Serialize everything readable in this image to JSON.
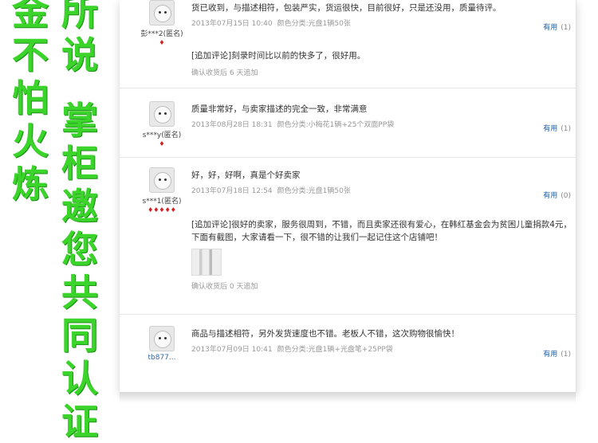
{
  "side_text": {
    "left_column": [
      "金",
      "不",
      "怕",
      "火",
      "炼"
    ],
    "right_column": [
      "所",
      "说",
      "掌",
      "柜",
      "邀",
      "您",
      "共",
      "同",
      "认",
      "证"
    ]
  },
  "reviews": [
    {
      "user": "彭***2(匿名)",
      "rank": "♦",
      "text": "货已收到，与描述相符，包装严实，货运很快，目前很好，只是还没用，质量待评。",
      "date": "2013年07月15日 10:40",
      "variant": "颜色分类:光盘1辆50张",
      "useful_label": "有用",
      "useful_count": "(1)",
      "additional": {
        "text": "[追加评论]刻录时间比以前的快多了，很好用。",
        "confirm": "确认收货后 6 天追加"
      }
    },
    {
      "user": "s***y(匿名)",
      "rank": "♦",
      "text": "质量非常好，与卖家描述的完全一致，非常满意",
      "date": "2013年08月28日 18:31",
      "variant": "颜色分类:小梅花1辆+25个双面PP袋",
      "useful_label": "有用",
      "useful_count": "(1)"
    },
    {
      "user": "s***1(匿名)",
      "rank": "♦♦♦♦♦",
      "text": "好，好，好啊，真是个好卖家",
      "date": "2013年07月18日 12:54",
      "variant": "颜色分类:光盘1辆50张",
      "useful_label": "有用",
      "useful_count": "(0)",
      "additional": {
        "text": "[追加评论]很好的卖家，服务很周到，不错，而且卖家还很有爱心，在韩红基金会为贫困儿童捐款4元，下面有截图，大家请看一下，很不错的让我们一起记住这个店铺吧！",
        "confirm": "确认收货后 0 天追加"
      }
    },
    {
      "user": "tb877...",
      "rank": "",
      "text": "商品与描述相符，另外发货速度也不错。老板人不错，这次购物很愉快！",
      "date": "2013年07月09日 10:41",
      "variant": "颜色分类:光盘1辆+光盘笔+25PP袋",
      "useful_label": "有用",
      "useful_count": "(1)"
    }
  ]
}
